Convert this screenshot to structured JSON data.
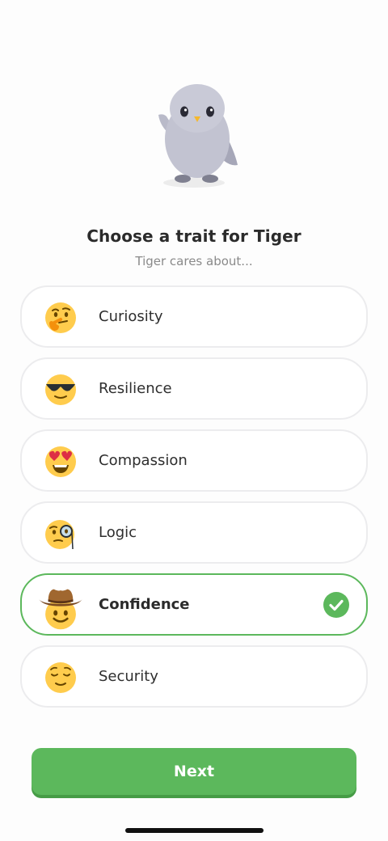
{
  "header": {
    "title": "Choose a trait for Tiger",
    "subtitle": "Tiger cares about..."
  },
  "mascot": {
    "icon": "penguin-mascot-icon"
  },
  "options": [
    {
      "label": "Curiosity",
      "icon": "thinking-face-icon",
      "selected": false
    },
    {
      "label": "Resilience",
      "icon": "sunglasses-face-icon",
      "selected": false
    },
    {
      "label": "Compassion",
      "icon": "heart-eyes-face-icon",
      "selected": false
    },
    {
      "label": "Logic",
      "icon": "monocle-face-icon",
      "selected": false
    },
    {
      "label": "Confidence",
      "icon": "cowboy-face-icon",
      "selected": true
    },
    {
      "label": "Security",
      "icon": "relieved-face-icon",
      "selected": false
    }
  ],
  "colors": {
    "accent": "#5cb85c",
    "title": "#2b2b2b",
    "subtitle": "#8a8a8a"
  },
  "footer": {
    "next_label": "Next"
  }
}
